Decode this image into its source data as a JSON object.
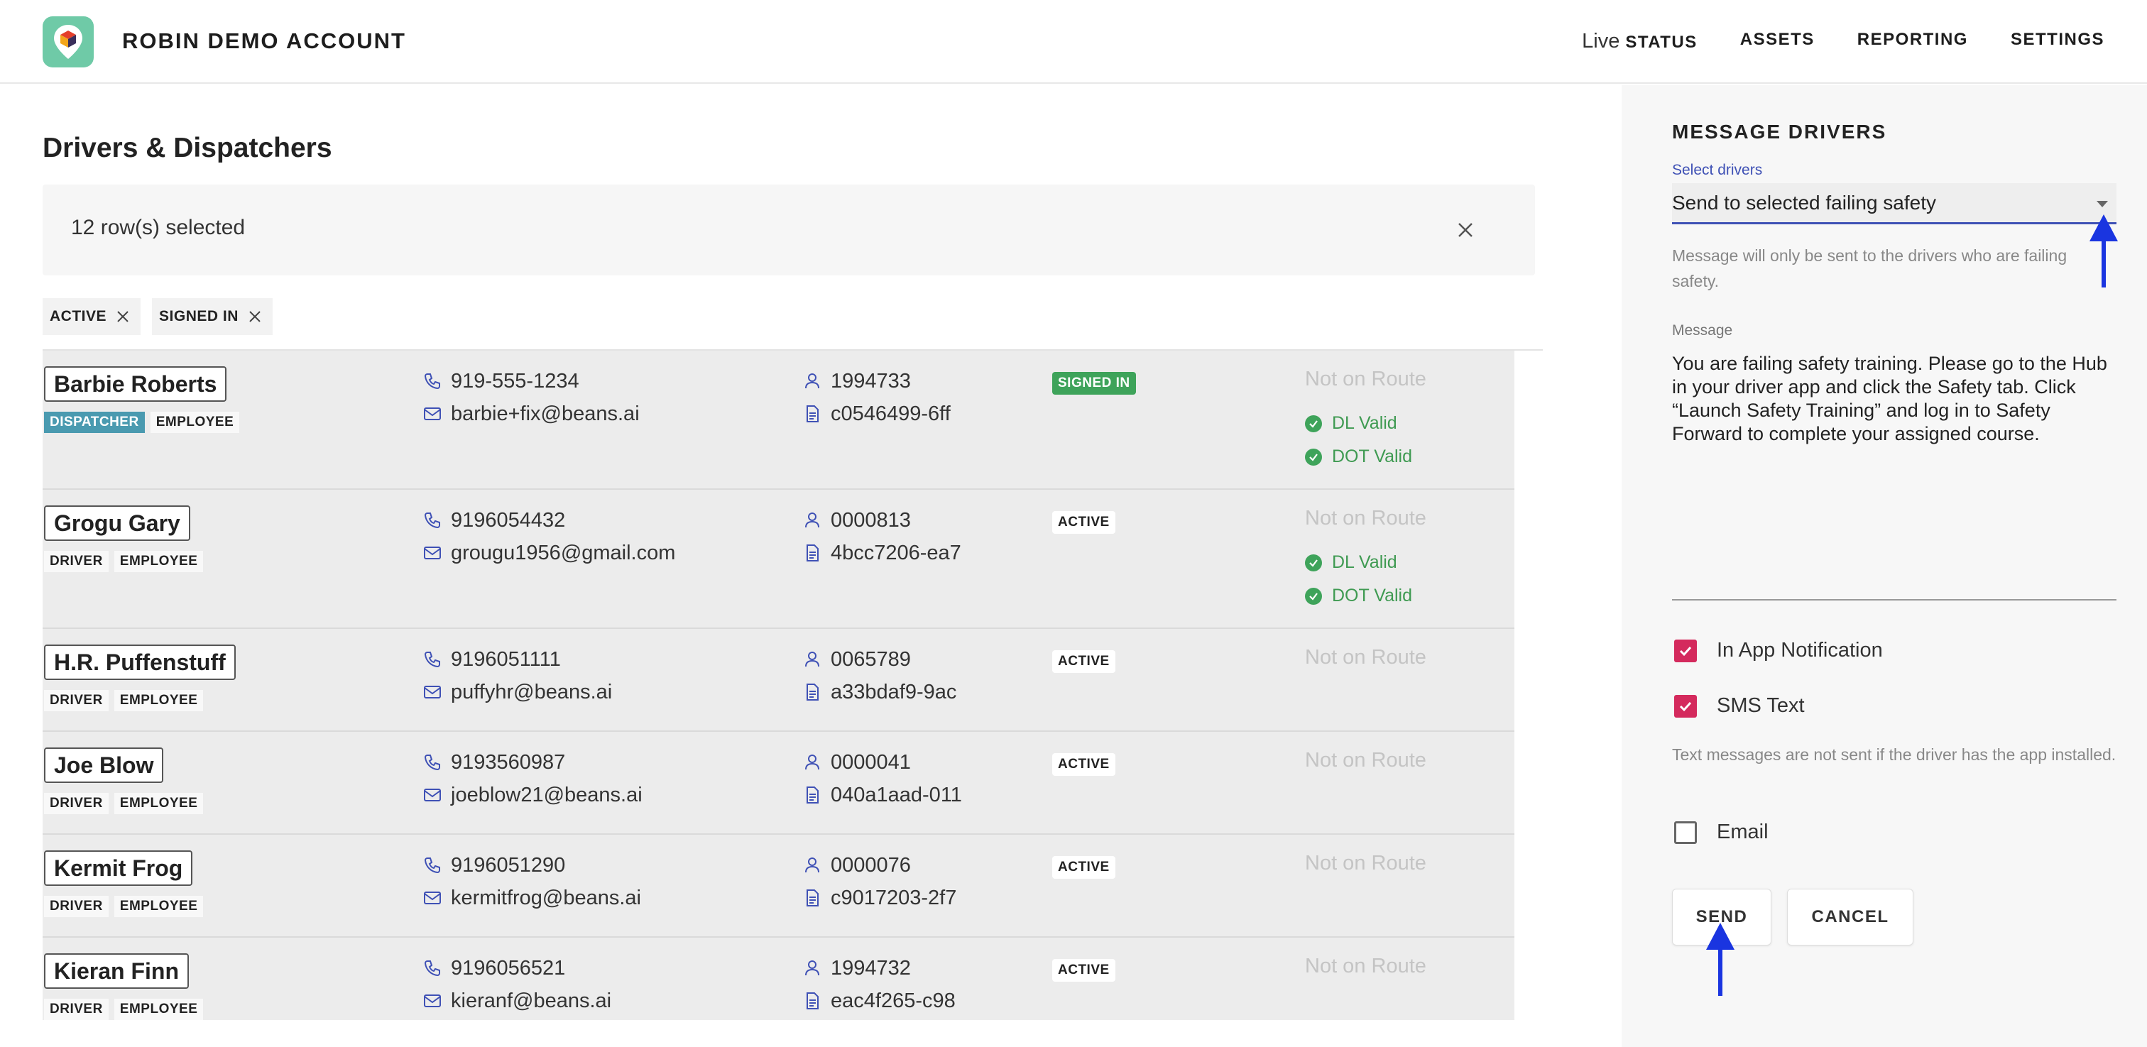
{
  "header": {
    "app_title": "ROBIN DEMO ACCOUNT",
    "nav": [
      {
        "prefix": "Live",
        "label": "STATUS"
      },
      {
        "prefix": "",
        "label": "ASSETS"
      },
      {
        "prefix": "",
        "label": "REPORTING"
      },
      {
        "prefix": "",
        "label": "SETTINGS"
      }
    ]
  },
  "main": {
    "title": "Drivers & Dispatchers",
    "selection_text": "12 row(s) selected",
    "filters": [
      {
        "label": "ACTIVE"
      },
      {
        "label": "SIGNED IN"
      }
    ],
    "rows": [
      {
        "name": "Barbie Roberts",
        "tags": [
          "DISPATCHER",
          "EMPLOYEE"
        ],
        "phone": "919-555-1234",
        "email": "barbie+fix@beans.ai",
        "employee_id": "1994733",
        "doc_id": "c0546499-6ff",
        "status": "SIGNED IN",
        "route": "Not on Route",
        "validations": [
          "DL Valid",
          "DOT Valid"
        ]
      },
      {
        "name": "Grogu Gary",
        "tags": [
          "DRIVER",
          "EMPLOYEE"
        ],
        "phone": "9196054432",
        "email": "grougu1956@gmail.com",
        "employee_id": "0000813",
        "doc_id": "4bcc7206-ea7",
        "status": "ACTIVE",
        "route": "Not on Route",
        "validations": [
          "DL Valid",
          "DOT Valid"
        ]
      },
      {
        "name": "H.R. Puffenstuff",
        "tags": [
          "DRIVER",
          "EMPLOYEE"
        ],
        "phone": "9196051111",
        "email": "puffyhr@beans.ai",
        "employee_id": "0065789",
        "doc_id": "a33bdaf9-9ac",
        "status": "ACTIVE",
        "route": "Not on Route",
        "validations": []
      },
      {
        "name": "Joe Blow",
        "tags": [
          "DRIVER",
          "EMPLOYEE"
        ],
        "phone": "9193560987",
        "email": "joeblow21@beans.ai",
        "employee_id": "0000041",
        "doc_id": "040a1aad-011",
        "status": "ACTIVE",
        "route": "Not on Route",
        "validations": []
      },
      {
        "name": "Kermit Frog",
        "tags": [
          "DRIVER",
          "EMPLOYEE"
        ],
        "phone": "9196051290",
        "email": "kermitfrog@beans.ai",
        "employee_id": "0000076",
        "doc_id": "c9017203-2f7",
        "status": "ACTIVE",
        "route": "Not on Route",
        "validations": []
      },
      {
        "name": "Kieran Finn",
        "tags": [
          "DRIVER",
          "EMPLOYEE"
        ],
        "phone": "9196056521",
        "email": "kieranf@beans.ai",
        "employee_id": "1994732",
        "doc_id": "eac4f265-c98",
        "status": "ACTIVE",
        "route": "Not on Route",
        "validations": []
      }
    ]
  },
  "panel": {
    "title": "MESSAGE DRIVERS",
    "select_label": "Select drivers",
    "select_value": "Send to selected failing safety",
    "select_helper": "Message will only be sent to the drivers who are failing safety.",
    "message_label": "Message",
    "message": "You are failing safety training. Please go to the Hub in your driver app and click the Safety tab. Click “Launch Safety Training” and log in to Safety Forward to complete your assigned course.",
    "in_app_label": "In App Notification",
    "in_app_checked": true,
    "sms_label": "SMS Text",
    "sms_checked": true,
    "sms_helper": "Text messages are not sent if the driver has the app installed.",
    "email_label": "Email",
    "email_checked": false,
    "send_label": "SEND",
    "cancel_label": "CANCEL"
  },
  "colors": {
    "accent": "#3f51b5",
    "checkbox": "#d42a5d",
    "signed_in": "#3ea35a",
    "dispatcher_tag": "#4a9ab0",
    "annotation_arrow": "#1a35e0"
  }
}
